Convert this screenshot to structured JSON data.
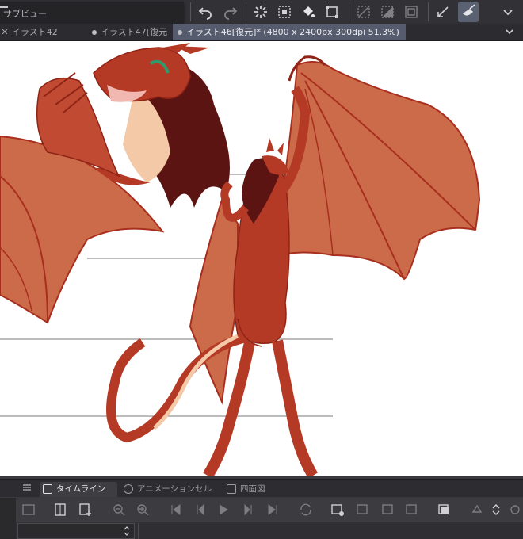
{
  "toolbar": {
    "subview_title": "サブビュー",
    "icons": [
      "menu-icon",
      "layer-icon",
      "up-icon",
      "new-icon",
      "copy-icon",
      "mirror-icon",
      "undo-icon",
      "redo-icon",
      "loading-icon",
      "clear-icon",
      "fill-icon",
      "transform-icon",
      "deselect-icon",
      "invert-icon",
      "border-icon",
      "erase-outside-icon",
      "fill-selection-icon"
    ]
  },
  "tabs": [
    {
      "label": "イラスト42",
      "active": false
    },
    {
      "label": "イラスト47[復元",
      "active": false
    },
    {
      "label": "イラスト46[復元]* (4800 x 2400px 300dpi 51.3%)",
      "active": true
    }
  ],
  "panel": {
    "tabs": [
      {
        "label": "タイムライン",
        "active": true
      },
      {
        "label": "アニメーションセル",
        "active": false
      },
      {
        "label": "四面図",
        "active": false
      }
    ]
  },
  "colors": {
    "body_red": "#b53a26",
    "wing_orange": "#cc6b4a",
    "dark_mane": "#5c1412",
    "cream": "#f3c9a8",
    "canvas_bg": "#ffffff",
    "guide_line": "#7a7a7a"
  }
}
